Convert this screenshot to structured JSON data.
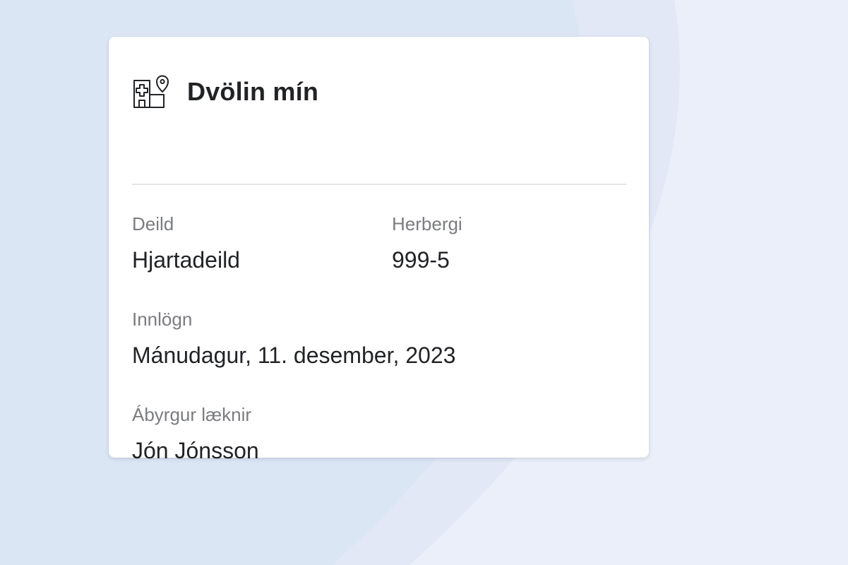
{
  "card": {
    "title": "Dvölin mín",
    "icon": "hospital-location-icon"
  },
  "fields": {
    "department": {
      "label": "Deild",
      "value": "Hjartadeild"
    },
    "room": {
      "label": "Herbergi",
      "value": "999-5"
    },
    "admission": {
      "label": "Innlögn",
      "value": "Mánudagur, 11. desember, 2023"
    },
    "physician": {
      "label": "Ábyrgur læknir",
      "value": "Jón Jónsson"
    }
  },
  "colors": {
    "page_background": "#eaeff9",
    "background_shape": "#dbe6f4",
    "card_background": "#ffffff",
    "text_primary": "#222326",
    "text_secondary": "#7b7c80",
    "divider": "#e3e5e9"
  }
}
